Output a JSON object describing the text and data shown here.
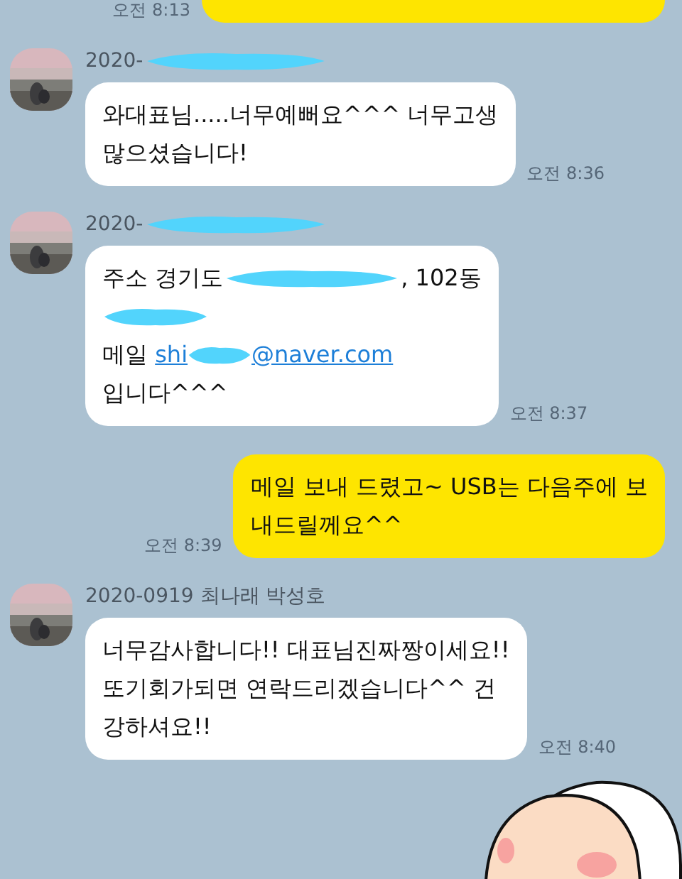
{
  "messages": [
    {
      "kind": "sent_partial",
      "time": "오전 8:13"
    },
    {
      "kind": "received",
      "sender": [
        {
          "kind": "text",
          "text": "2020-"
        },
        {
          "kind": "redaction"
        }
      ],
      "lines": [
        [
          {
            "kind": "text",
            "text": "와대표님.....너무예뻐요^^^ 너무고생"
          }
        ],
        [
          {
            "kind": "text",
            "text": "많으셨습니다!"
          }
        ]
      ],
      "time": "오전 8:36"
    },
    {
      "kind": "received",
      "sender": [
        {
          "kind": "text",
          "text": "2020-"
        },
        {
          "kind": "redaction"
        }
      ],
      "lines": [
        [
          {
            "kind": "text",
            "text": "주소 경기도"
          },
          {
            "kind": "redaction"
          },
          {
            "kind": "text",
            "text": ", 102동"
          }
        ],
        [
          {
            "kind": "redaction"
          }
        ],
        [
          {
            "kind": "text",
            "text": "메일 "
          },
          {
            "kind": "link",
            "text": "shi"
          },
          {
            "kind": "redaction"
          },
          {
            "kind": "link",
            "text": "@naver.com"
          }
        ],
        [
          {
            "kind": "text",
            "text": "입니다^^^"
          }
        ]
      ],
      "time": "오전 8:37"
    },
    {
      "kind": "sent",
      "lines": [
        [
          {
            "kind": "text",
            "text": "메일 보내 드렸고~ USB는 다음주에 보"
          }
        ],
        [
          {
            "kind": "text",
            "text": "내드릴께요^^"
          }
        ]
      ],
      "time": "오전 8:39"
    },
    {
      "kind": "received",
      "sender": [
        {
          "kind": "text",
          "text": "2020-0919 최나래 박성호"
        }
      ],
      "lines": [
        [
          {
            "kind": "text",
            "text": "너무감사합니다!! 대표님진짜짱이세요!!"
          }
        ],
        [
          {
            "kind": "text",
            "text": "또기회가되면 연락드리겠습니다^^ 건"
          }
        ],
        [
          {
            "kind": "text",
            "text": "강하셔요!!"
          }
        ]
      ],
      "time": "오전 8:40"
    },
    {
      "kind": "sticker"
    }
  ]
}
